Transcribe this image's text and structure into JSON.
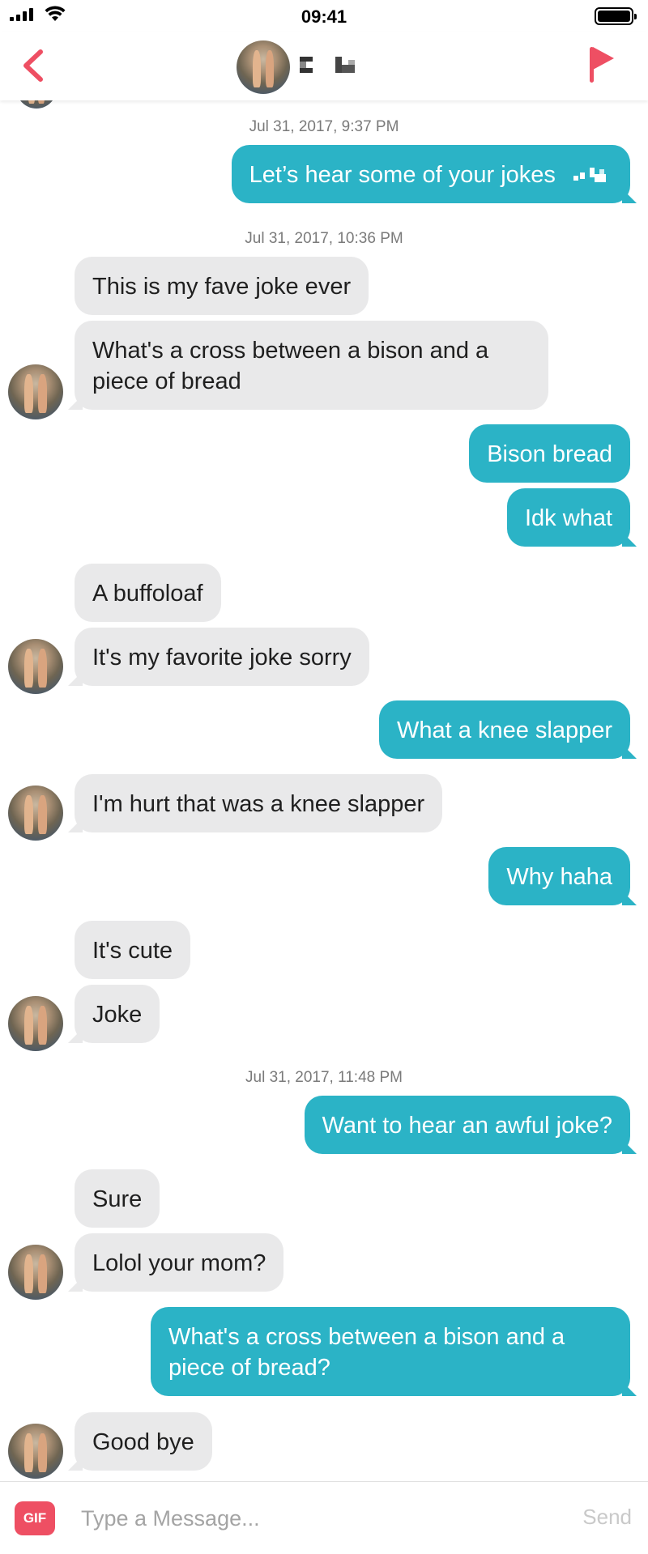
{
  "status_bar": {
    "time": "09:41"
  },
  "header": {
    "back_icon": "chevron-left-icon",
    "flag_icon": "flag-icon",
    "accent_color": "#ee4f63"
  },
  "messages": [
    {
      "type": "timestamp",
      "text": "Jul 31, 2017, 9:37 PM"
    },
    {
      "type": "outgoing",
      "text": "Let’s hear some of your jokes"
    },
    {
      "type": "timestamp",
      "text": "Jul 31, 2017, 10:36 PM"
    },
    {
      "type": "incoming",
      "text": "This is my fave joke ever"
    },
    {
      "type": "incoming",
      "text": "What's a cross between a bison and a piece of bread"
    },
    {
      "type": "outgoing",
      "text": "Bison bread"
    },
    {
      "type": "outgoing",
      "text": "Idk what"
    },
    {
      "type": "incoming",
      "text": "A buffoloaf"
    },
    {
      "type": "incoming",
      "text": "It's my favorite joke sorry"
    },
    {
      "type": "outgoing",
      "text": "What a knee slapper"
    },
    {
      "type": "incoming",
      "text": "I'm hurt that was a knee slapper"
    },
    {
      "type": "outgoing",
      "text": "Why haha"
    },
    {
      "type": "incoming",
      "text": "It's cute"
    },
    {
      "type": "incoming",
      "text": "Joke"
    },
    {
      "type": "timestamp",
      "text": "Jul 31, 2017, 11:48 PM"
    },
    {
      "type": "outgoing",
      "text": "Want to hear an awful joke?"
    },
    {
      "type": "incoming",
      "text": "Sure"
    },
    {
      "type": "incoming",
      "text": "Lolol your mom?"
    },
    {
      "type": "outgoing",
      "text": "What's a cross between a bison and a piece of bread?"
    },
    {
      "type": "incoming",
      "text": "Good bye"
    }
  ],
  "composer": {
    "gif_label": "GIF",
    "placeholder": "Type a Message...",
    "send_label": "Send"
  },
  "colors": {
    "outgoing_bubble": "#2bb3c6",
    "incoming_bubble": "#e9e9ea",
    "gif_button": "#ee4f63"
  }
}
